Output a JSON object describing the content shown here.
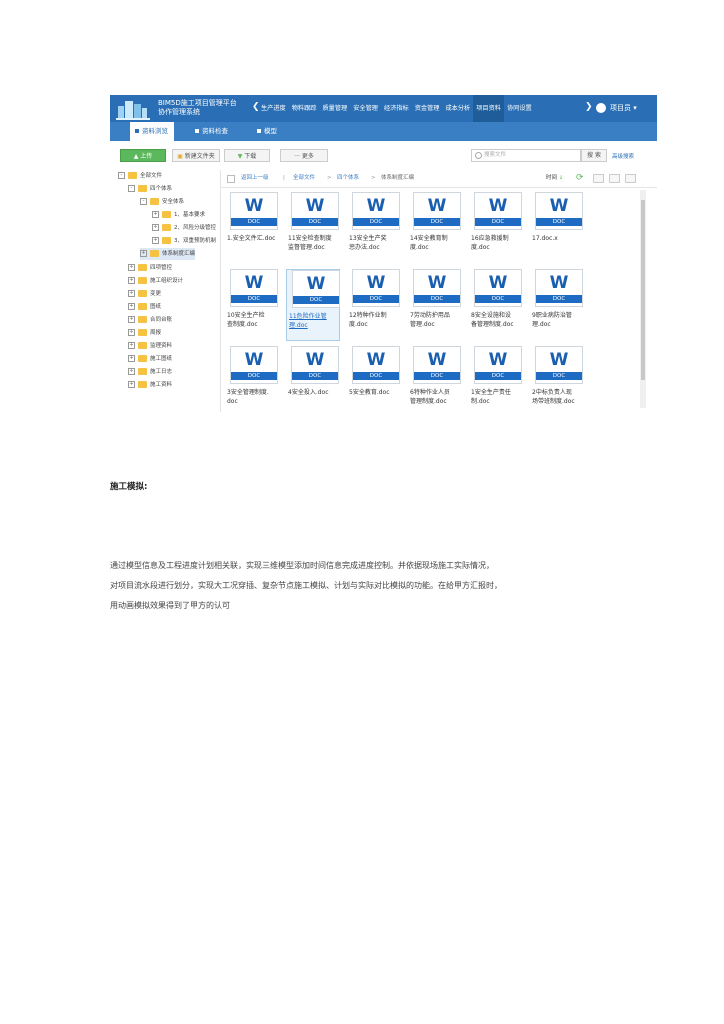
{
  "app": {
    "title_line1": "BIM5D施工项目管理平台",
    "title_line2": "协作管理系统"
  },
  "nav": {
    "items": [
      "生产进度",
      "物料跟踪",
      "质量管理",
      "安全管理",
      "经济指标",
      "资金管理",
      "成本分析",
      "项目资料",
      "协同设置"
    ],
    "active_index": 7,
    "user": "项目员"
  },
  "subtabs": [
    {
      "label": "资料浏览",
      "active": true
    },
    {
      "label": "资料检查",
      "active": false
    },
    {
      "label": "模型",
      "active": false
    }
  ],
  "toolbar": {
    "upload": "上传",
    "new_folder": "新建文件夹",
    "download": "下载",
    "more": "更多",
    "search_placeholder": "搜索文件",
    "search_btn": "搜 索",
    "advanced": "高级搜索"
  },
  "tree": [
    {
      "label": "全部文件",
      "level": 0,
      "toggle": "-"
    },
    {
      "label": "四个体系",
      "level": 1,
      "toggle": "-"
    },
    {
      "label": "安全体系",
      "level": 2,
      "toggle": "-"
    },
    {
      "label": "1、基本要求",
      "level": 3,
      "toggle": "+"
    },
    {
      "label": "2、风险分级管控",
      "level": 3,
      "toggle": "+"
    },
    {
      "label": "3、双重预防机制",
      "level": 3,
      "toggle": "+"
    },
    {
      "label": "体系制度汇编",
      "level": 2,
      "toggle": "+",
      "selected": true
    },
    {
      "label": "四项管控",
      "level": 1,
      "toggle": "+"
    },
    {
      "label": "施工组织设计",
      "level": 1,
      "toggle": "+"
    },
    {
      "label": "变更",
      "level": 1,
      "toggle": "+"
    },
    {
      "label": "图纸",
      "level": 1,
      "toggle": "+"
    },
    {
      "label": "合同台账",
      "level": 1,
      "toggle": "+"
    },
    {
      "label": "周报",
      "level": 1,
      "toggle": "+"
    },
    {
      "label": "监理资料",
      "level": 1,
      "toggle": "+"
    },
    {
      "label": "施工图纸",
      "level": 1,
      "toggle": "+"
    },
    {
      "label": "施工日志",
      "level": 1,
      "toggle": "+"
    },
    {
      "label": "施工资料",
      "level": 1,
      "toggle": "+"
    }
  ],
  "breadcrumb": [
    "返回上一级",
    "全部文件",
    "四个体系",
    "体系制度汇编"
  ],
  "sort_label": "时间",
  "doc_badge": "DOC",
  "files": [
    "1.安全文件汇.doc",
    "11安全检查制度\n监督管理.doc",
    "13安全生产奖\n惩办法.doc",
    "14安全教育制\n度.doc",
    "16应急救援制\n度.doc",
    "17.doc.x",
    "10安全生产检\n查制度.doc",
    "11危险作业管\n理.doc",
    "12特种作业制\n度.doc",
    "7劳动防护用品\n管理.doc",
    "8安全设施和设\n备管理制度.doc",
    "9职业病防治管\n理.doc",
    "3安全管理制度.\ndoc",
    "4安全投入.doc",
    "5安全教育.doc",
    "6特种作业人员\n管理制度.doc",
    "1安全生产责任\n制.doc",
    "2中标负责人现\n场带班制度.doc"
  ],
  "selected_file_index": 7,
  "section": {
    "title": "施工模拟:",
    "paragraph_lines": [
      "通过模型信息及工程进度计划相关联，实现三维模型添加时间信息完成进度控制。并依据现场施工实际情况，",
      "对项目流水段进行划分，实现大工况穿插、复杂节点施工模拟、计划与实际对比模拟的功能。在给甲方汇报时，",
      "用动画模拟效果得到了甲方的认可"
    ]
  },
  "colors": {
    "brand_blue": "#2a6fb5",
    "word_blue": "#1d6bc2",
    "folder_yellow": "#f5c242",
    "upload_green": "#5cb85c"
  }
}
